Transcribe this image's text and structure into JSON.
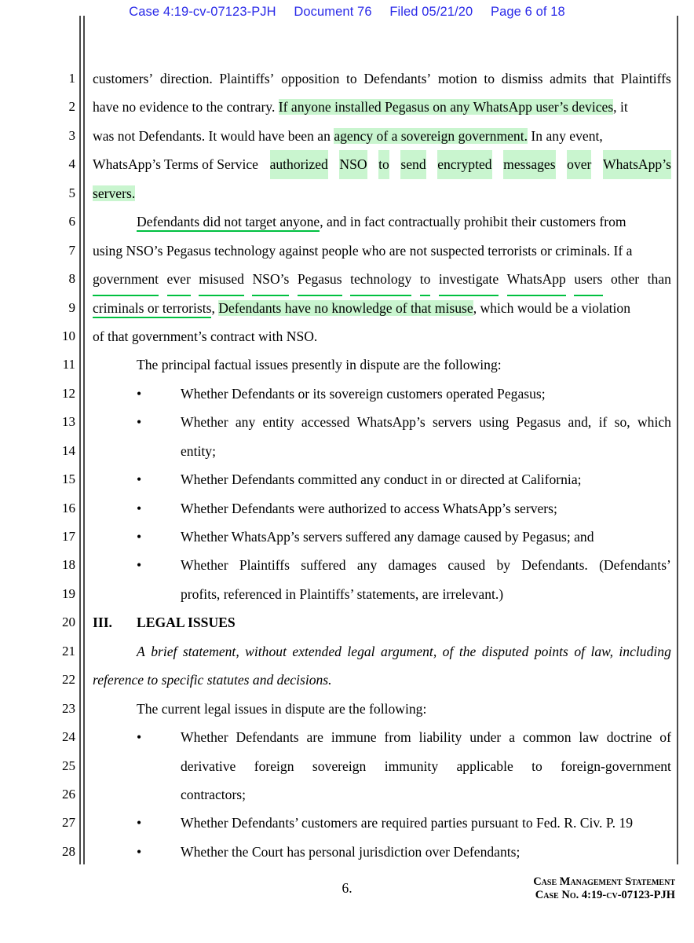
{
  "header": {
    "case": "Case 4:19-cv-07123-PJH",
    "document": "Document 76",
    "filed": "Filed 05/21/20",
    "page": "Page 6 of 18",
    "color": "#2a2ae8"
  },
  "colors": {
    "highlight_green": "#c9f5cf",
    "underline_green": "#00c040",
    "rule_gray": "#4a4a4a"
  },
  "line_numbers": [
    "1",
    "2",
    "3",
    "4",
    "5",
    "6",
    "7",
    "8",
    "9",
    "10",
    "11",
    "12",
    "13",
    "14",
    "15",
    "16",
    "17",
    "18",
    "19",
    "20",
    "21",
    "22",
    "23",
    "24",
    "25",
    "26",
    "27",
    "28"
  ],
  "lines": {
    "l1": {
      "w1": "customers’",
      "w2": "direction.",
      "w3": "Plaintiffs’",
      "w4": "opposition",
      "w5": "to",
      "w6": "Defendants’",
      "w7": "motion",
      "w8": "to",
      "w9": "dismiss",
      "w10": "admits",
      "w11": "that",
      "w12": "Plaintiffs"
    },
    "l2": {
      "plain": "have no evidence to the contrary.",
      "hl": "If anyone installed Pegasus on any WhatsApp user’s devices",
      "tail": ", it"
    },
    "l3": {
      "pre": "was not Defendants. It would have been an ",
      "hl": "agency of a sovereign government.",
      "tail": " In any event,"
    },
    "l4": {
      "pre": "WhatsApp’s Terms of Service ",
      "hl_w1": "authorized",
      "hl_w2": "NSO",
      "hl_w3": "to",
      "hl_w4": "send",
      "hl_w5": "encrypted",
      "hl_w6": "messages",
      "hl_w7": "over",
      "hl_w8": "WhatsApp’s"
    },
    "l5": {
      "hl": "servers."
    },
    "l6": {
      "ul": "Defendants did not target anyone",
      "tail": ", and in fact contractually prohibit their customers from"
    },
    "l7": {
      "text": "using NSO’s Pegasus technology against people who are not suspected terrorists or criminals. If a"
    },
    "l8": {
      "ul_w1": "government",
      "ul_w2": "ever",
      "ul_w3": "misused",
      "ul_w4": "NSO’s",
      "ul_w5": "Pegasus",
      "ul_w6": "technology",
      "ul_w7": "to",
      "ul_w8": "investigate",
      "ul_w9": "WhatsApp",
      "ul_w10": "users",
      "t1": "other",
      "t2": "than"
    },
    "l9": {
      "ul": "criminals or terrorists",
      "mid": ", ",
      "hl": "Defendants have no knowledge of that misuse",
      "tail": ", which would be a violation"
    },
    "l10": {
      "text": "of that government’s contract with NSO."
    },
    "l11": {
      "text": "The principal factual issues presently in dispute are the following:"
    },
    "l12": {
      "bullet": "•",
      "text": "Whether Defendants or its sovereign customers operated Pegasus;"
    },
    "l13": {
      "bullet": "•",
      "w1": "Whether",
      "w2": "any",
      "w3": "entity",
      "w4": "accessed",
      "w5": "WhatsApp’s",
      "w6": "servers",
      "w7": "using",
      "w8": "Pegasus",
      "w9": "and,",
      "w10": "if",
      "w11": "so,",
      "w12": "which"
    },
    "l14": {
      "text": "entity;"
    },
    "l15": {
      "bullet": "•",
      "text": "Whether Defendants committed any conduct in or directed at California;"
    },
    "l16": {
      "bullet": "•",
      "text": "Whether Defendants were authorized to access WhatsApp’s servers;"
    },
    "l17": {
      "bullet": "•",
      "text": "Whether WhatsApp’s servers suffered any damage caused by Pegasus; and"
    },
    "l18": {
      "bullet": "•",
      "w1": "Whether",
      "w2": "Plaintiffs",
      "w3": "suffered",
      "w4": "any",
      "w5": "damages",
      "w6": "caused",
      "w7": "by",
      "w8": "Defendants.",
      "w9": "(Defendants’"
    },
    "l19": {
      "text": "profits, referenced in Plaintiffs’ statements, are irrelevant.)"
    },
    "l20": {
      "number": "III.",
      "title": "LEGAL ISSUES"
    },
    "l21": {
      "w1": "A",
      "w2": "brief",
      "w3": "statement,",
      "w4": "without",
      "w5": "extended",
      "w6": "legal",
      "w7": "argument,",
      "w8": "of",
      "w9": "the",
      "w10": "disputed",
      "w11": "points",
      "w12": "of",
      "w13": "law,",
      "w14": "including"
    },
    "l22": {
      "text": "reference to specific statutes and decisions."
    },
    "l23": {
      "text": "The current legal issues in dispute are the following:"
    },
    "l24": {
      "bullet": "•",
      "w1": "Whether",
      "w2": "Defendants",
      "w3": "are",
      "w4": "immune",
      "w5": "from",
      "w6": "liability",
      "w7": "under",
      "w8": "a",
      "w9": "common",
      "w10": "law",
      "w11": "doctrine",
      "w12": "of"
    },
    "l25": {
      "w1": "derivative",
      "w2": "foreign",
      "w3": "sovereign",
      "w4": "immunity",
      "w5": "applicable",
      "w6": "to",
      "w7": "foreign-government"
    },
    "l26": {
      "text": "contractors;"
    },
    "l27": {
      "bullet": "•",
      "text": "Whether Defendants’ customers are required parties pursuant to Fed. R. Civ. P. 19"
    },
    "l28": {
      "bullet": "•",
      "text": "Whether the Court has personal jurisdiction over Defendants;"
    }
  },
  "footer": {
    "page_number": "6.",
    "caption_line1": "Case Management Statement",
    "caption_line2": "Case No. 4:19-cv-07123-PJH"
  }
}
